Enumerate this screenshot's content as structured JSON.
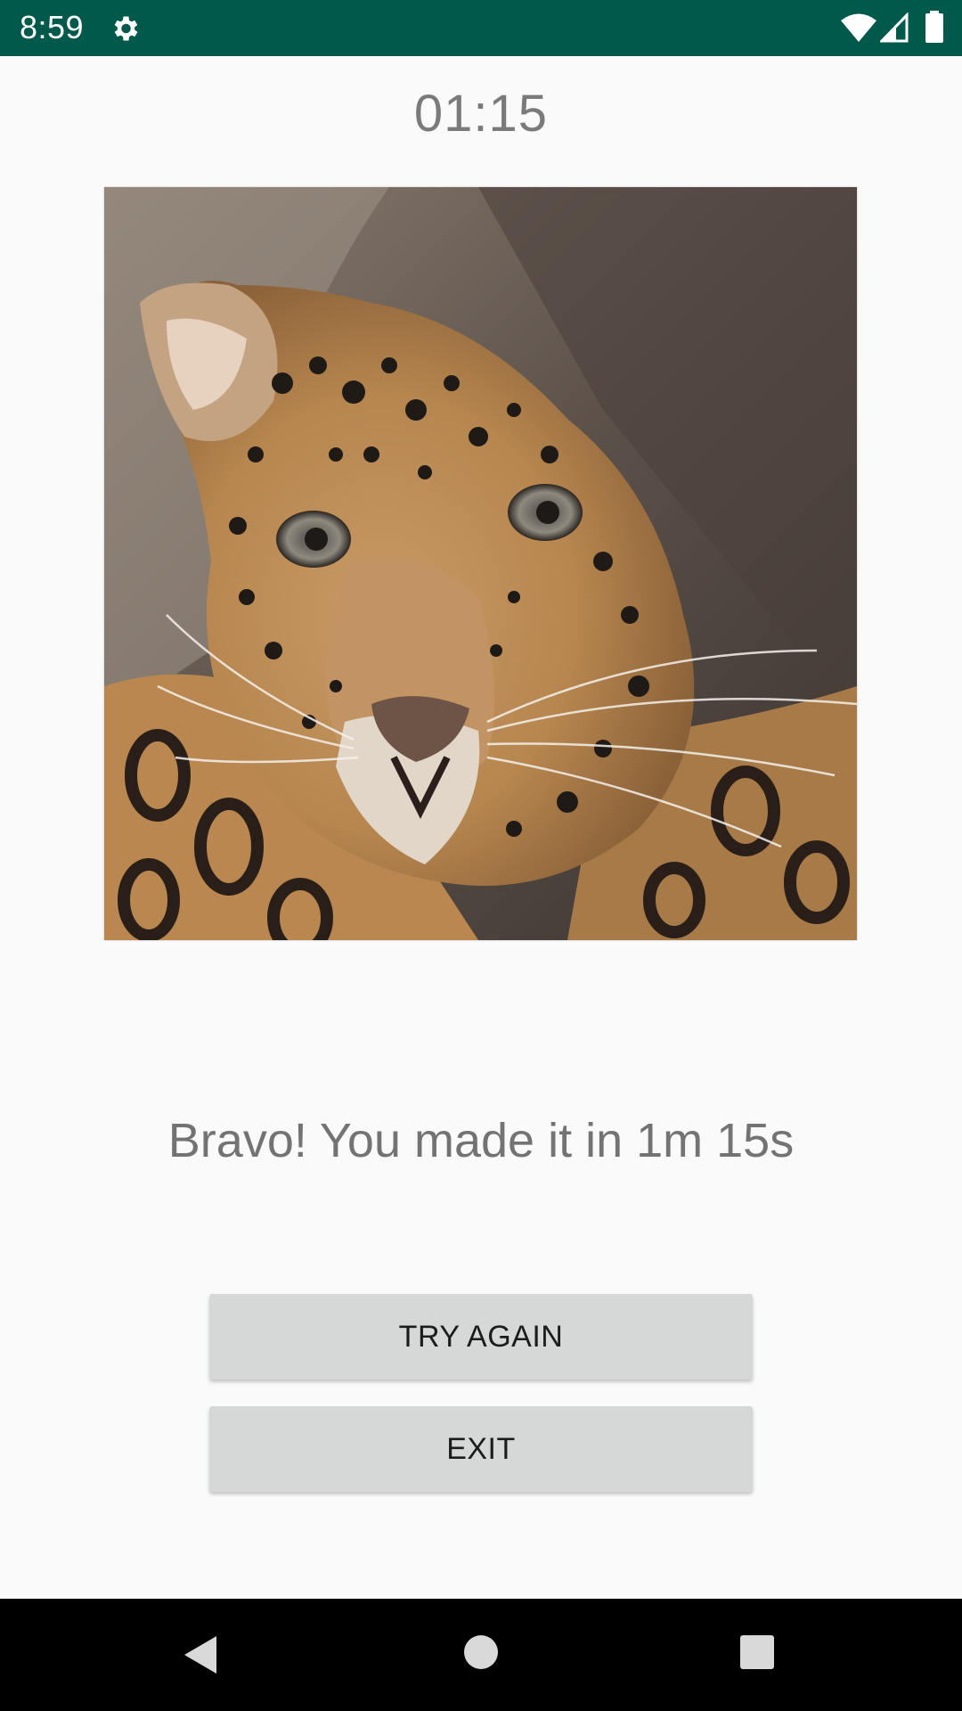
{
  "status_bar": {
    "time": "8:59",
    "icons": [
      "gear-icon",
      "wifi-icon",
      "cell-signal-icon",
      "battery-icon"
    ],
    "background": "#00594b"
  },
  "game": {
    "timer": "01:15",
    "image_icon": "leopard-photo",
    "message": "Bravo! You made it in 1m 15s"
  },
  "buttons": {
    "try_again": "TRY AGAIN",
    "exit": "EXIT"
  },
  "nav_bar": {
    "icons": [
      "back-icon",
      "home-icon",
      "recents-icon"
    ]
  }
}
